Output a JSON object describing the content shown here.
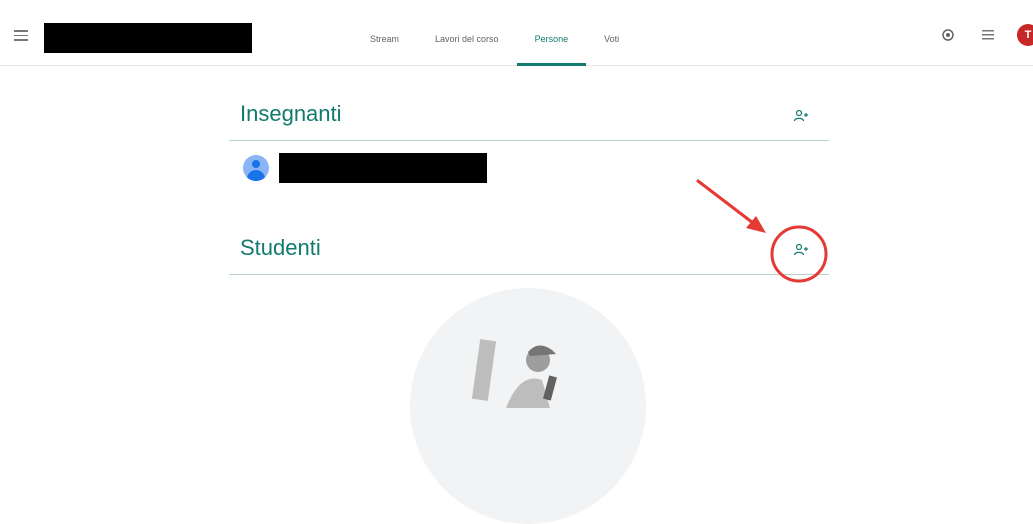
{
  "header": {
    "tabs": [
      {
        "label": "Stream",
        "active": false
      },
      {
        "label": "Lavori del corso",
        "active": false
      },
      {
        "label": "Persone",
        "active": true
      },
      {
        "label": "Voti",
        "active": false
      }
    ],
    "user_initial": "T",
    "icons": [
      "menu-icon",
      "settings-icon",
      "apps-icon"
    ]
  },
  "sections": {
    "teachers_title": "Insegnanti",
    "students_title": "Studenti"
  },
  "colors": {
    "accent": "#127b6e",
    "annotation_red": "#e53935",
    "avatar_red": "#c62828"
  }
}
